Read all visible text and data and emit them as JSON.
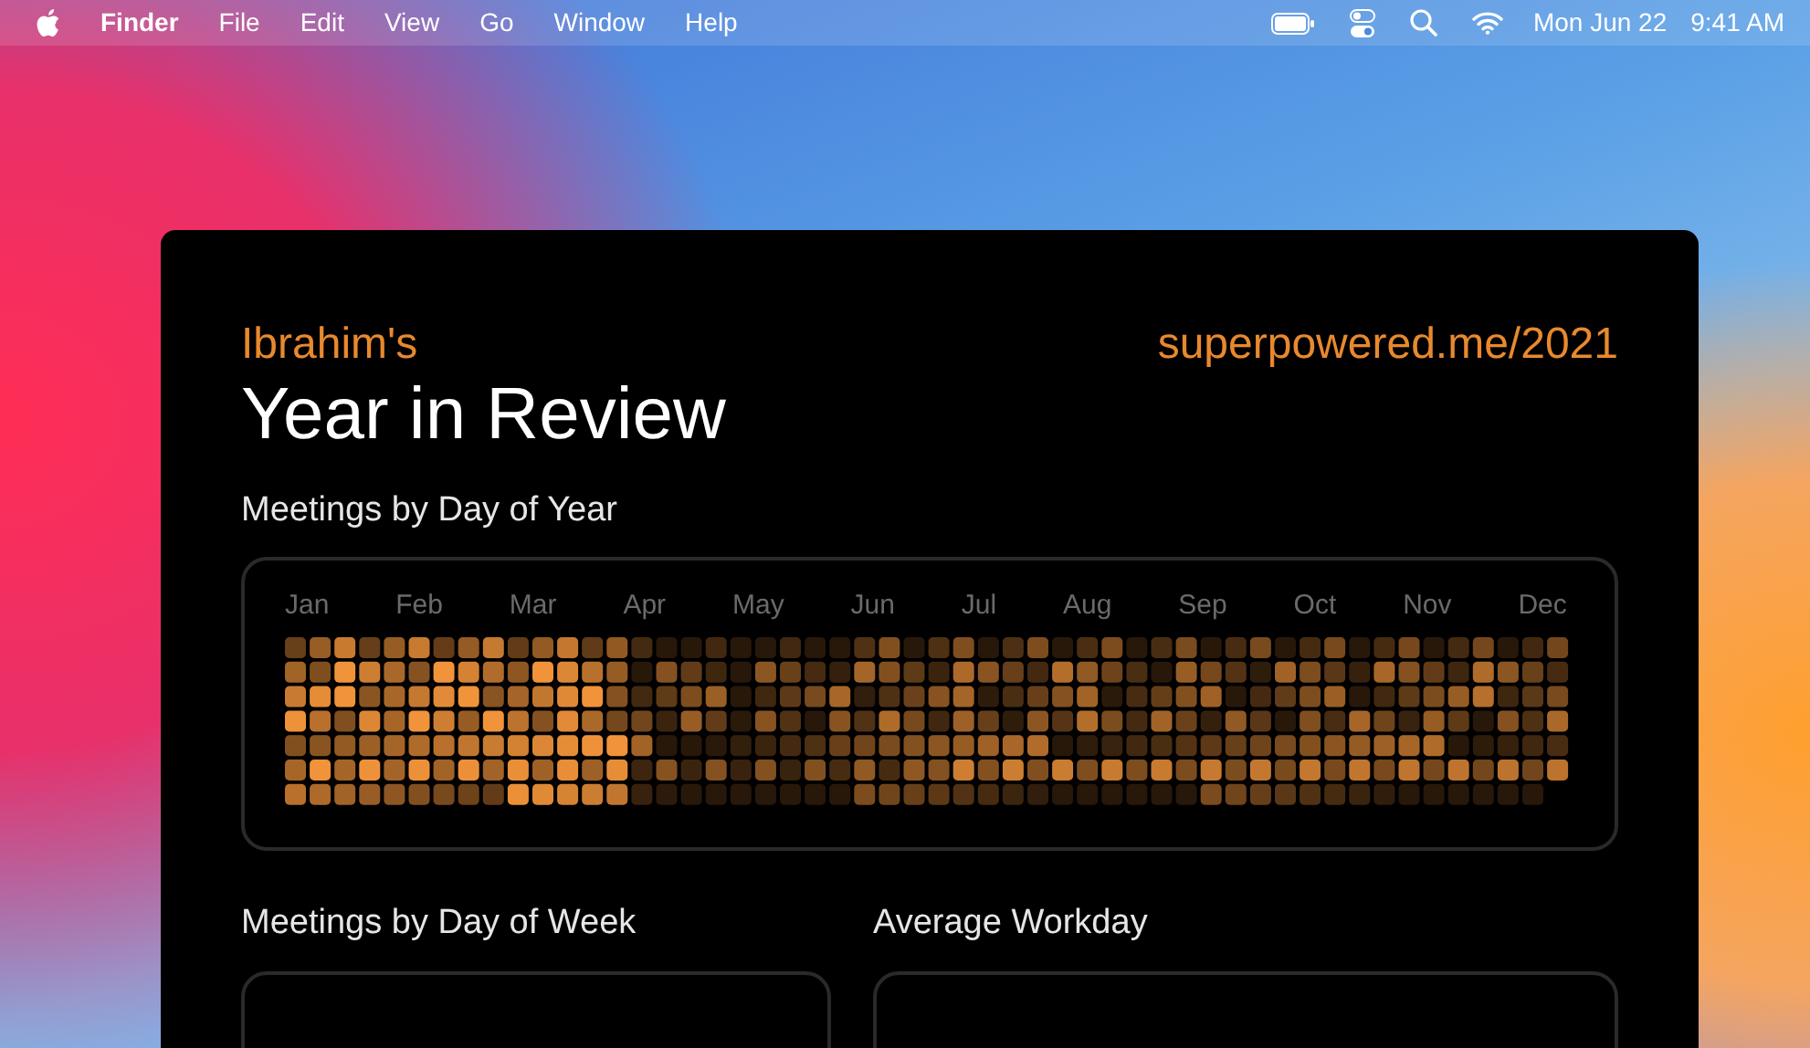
{
  "menu_bar": {
    "app": "Finder",
    "items": [
      "File",
      "Edit",
      "View",
      "Go",
      "Window",
      "Help"
    ],
    "date": "Mon Jun 22",
    "time": "9:41 AM"
  },
  "card": {
    "owner": "Ibrahim's",
    "title": "Year in Review",
    "url": "superpowered.me/2021",
    "day_of_year": {
      "title": "Meetings by Day of Year",
      "months": [
        "Jan",
        "Feb",
        "Mar",
        "Apr",
        "May",
        "Jun",
        "Jul",
        "Aug",
        "Sep",
        "Oct",
        "Nov",
        "Dec"
      ]
    },
    "panels": [
      {
        "title": "Meetings by Day of Week"
      },
      {
        "title": "Average Workday"
      }
    ]
  }
}
